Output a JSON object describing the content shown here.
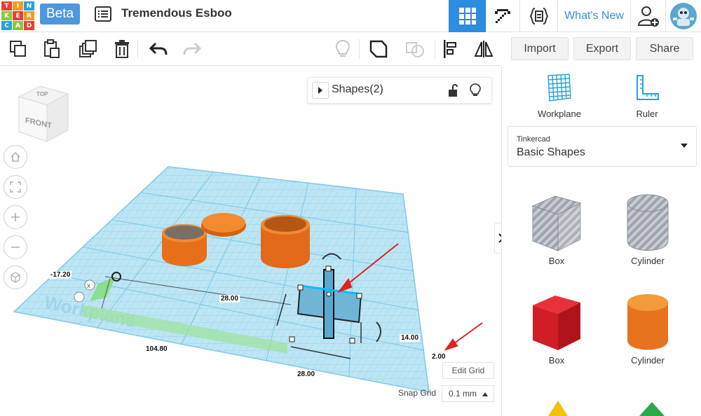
{
  "app": {
    "logo_letters": [
      "T",
      "I",
      "N",
      "K",
      "E",
      "R",
      "C",
      "A",
      "D"
    ],
    "logo_colors": [
      "#e8402f",
      "#f29b24",
      "#2a9fd8",
      "#8fc444",
      "#e8402f",
      "#f29b24",
      "#2a9fd8",
      "#8fc444",
      "#e8402f"
    ],
    "beta_label": "Beta",
    "project_title": "Tremendous Esboo",
    "whats_new_label": "What's New",
    "accent_color": "#2d8de0"
  },
  "toolbar": {
    "import_label": "Import",
    "export_label": "Export",
    "share_label": "Share"
  },
  "right_panel": {
    "workplane_label": "Workplane",
    "ruler_label": "Ruler",
    "library": {
      "provider": "Tinkercad",
      "name": "Basic Shapes"
    },
    "shapes": [
      {
        "label": "Box",
        "icon": "box-striped-icon"
      },
      {
        "label": "Cylinder",
        "icon": "cylinder-striped-icon"
      },
      {
        "label": "Box",
        "icon": "box-red-icon"
      },
      {
        "label": "Cylinder",
        "icon": "cylinder-orange-icon"
      }
    ]
  },
  "viewport": {
    "shapes_panel_title": "Shapes(2)",
    "view_cube": {
      "top": "TOP",
      "front": "FRONT"
    },
    "workplane_text": "Workplane",
    "dimensions": {
      "x_offset": "-17.20",
      "length_a": "28.00",
      "length_b": "104.80",
      "length_c": "28.00",
      "height": "14.00",
      "elevation": "2.00"
    },
    "edit_grid_label": "Edit Grid",
    "snap_grid_label": "Snap Grid",
    "snap_grid_value": "0.1 mm"
  }
}
